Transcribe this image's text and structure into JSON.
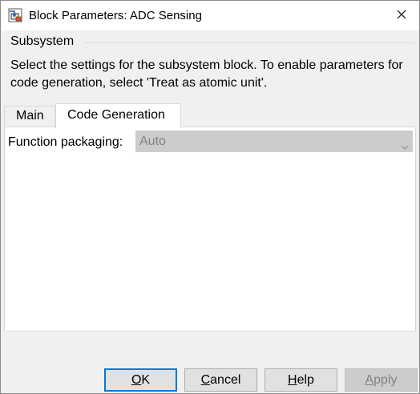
{
  "window": {
    "title": "Block Parameters: ADC Sensing",
    "close_icon": "close-icon",
    "app_icon": "simulink-block-icon"
  },
  "group": {
    "title": "Subsystem",
    "description": "Select the settings for the subsystem block. To enable parameters for code generation, select 'Treat as atomic unit'."
  },
  "tabs": [
    {
      "label": "Main",
      "active": false
    },
    {
      "label": "Code Generation",
      "active": true
    }
  ],
  "code_generation": {
    "function_packaging_label": "Function packaging:",
    "function_packaging_value": "Auto",
    "function_packaging_enabled": false
  },
  "buttons": {
    "ok": {
      "mnemonic": "O",
      "rest": "K"
    },
    "cancel": {
      "mnemonic": "C",
      "rest": "ancel"
    },
    "help": {
      "mnemonic": "H",
      "rest": "elp"
    },
    "apply": {
      "mnemonic": "A",
      "rest": "pply",
      "enabled": false
    }
  },
  "colors": {
    "focus_border": "#0078d7",
    "disabled_text": "#838383"
  }
}
